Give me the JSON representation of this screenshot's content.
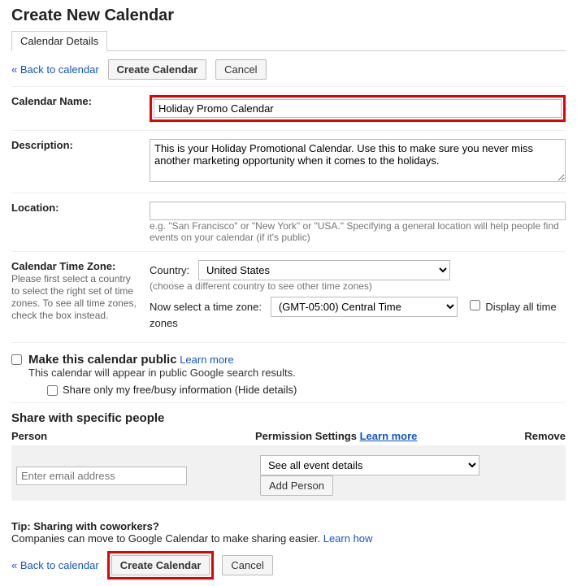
{
  "page_title": "Create New Calendar",
  "tab_label": "Calendar Details",
  "back_link": "« Back to calendar",
  "create_button": "Create Calendar",
  "cancel_button": "Cancel",
  "name_label": "Calendar Name:",
  "name_value": "Holiday Promo Calendar",
  "desc_label": "Description:",
  "desc_value": "This is your Holiday Promotional Calendar. Use this to make sure you never miss another marketing opportunity when it comes to the holidays.",
  "loc_label": "Location:",
  "loc_hint": "e.g. \"San Francisco\" or \"New York\" or \"USA.\" Specifying a general location will help people find events on your calendar (if it's public)",
  "tz_label": "Calendar Time Zone:",
  "tz_sub": "Please first select a country to select the right set of time zones. To see all time zones, check the box instead.",
  "tz_country_label": "Country:",
  "tz_country_value": "United States",
  "tz_country_hint": "(choose a different country to see other time zones)",
  "tz_select_label": "Now select a time zone:",
  "tz_value": "(GMT-05:00) Central Time",
  "tz_all_label": "Display all time zones",
  "public_label": "Make this calendar public",
  "public_learn": "Learn more",
  "public_hint": "This calendar will appear in public Google search results.",
  "public_freebusy": "Share only my free/busy information (Hide details)",
  "share_heading": "Share with specific people",
  "share_person_header": "Person",
  "share_perm_header": "Permission Settings",
  "share_learn": "Learn more",
  "share_remove_header": "Remove",
  "share_email_placeholder": "Enter email address",
  "share_perm_value": "See all event details",
  "share_add_button": "Add Person",
  "tip_heading": "Tip: Sharing with coworkers?",
  "tip_text": "Companies can move to Google Calendar to make sharing easier. ",
  "tip_learn": "Learn how"
}
